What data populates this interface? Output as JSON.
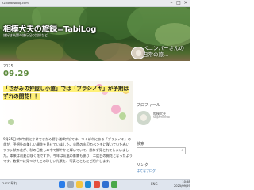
{
  "browser": {
    "address": "ZZhoutosblog.com"
  },
  "header": {
    "title": "相模犬夫の旅録",
    "title_suffix": "TabiLog",
    "subtitle": "旅好き夫婦の旅行記の記録など",
    "side_title_line1": "ペニンバーさんの",
    "side_title_line2": "日常の旅..."
  },
  "post": {
    "day_label": "2025",
    "date": "09.29",
    "title_part1": "「さがみの狆屋し小道」では「ブラシノキ」が予期はずれの開花！！",
    "body": "9月25日(木)午前にかけてさがみ野小道(町内)では、つくば市にある「ブラシノキ」の花が、予想外の美しい開花を見せていました。公園の水辺のベンチに咲いていた赤いブラシ状の花が、秋の日差しの中で鮮やかに輝いていて、思わず見とれてしまいました。本来は初夏に咲く花ですが、今年は気温の影響もあり、二度目の開花となったようです。散策中に見つけたこの珍しい光景を、写真とともにご紹介します。"
  },
  "sidebar": {
    "profile_label": "プロフィール",
    "profile_name": "相模犬夫",
    "profile_id": "sagamiinuo",
    "search_label": "検索",
    "link_label": "リンク",
    "link_item": "はてなブログ"
  },
  "taskbar": {
    "weather": "24°C 晴れ",
    "time": "10:58",
    "date": "2025/09/29",
    "tray": "ENG"
  }
}
